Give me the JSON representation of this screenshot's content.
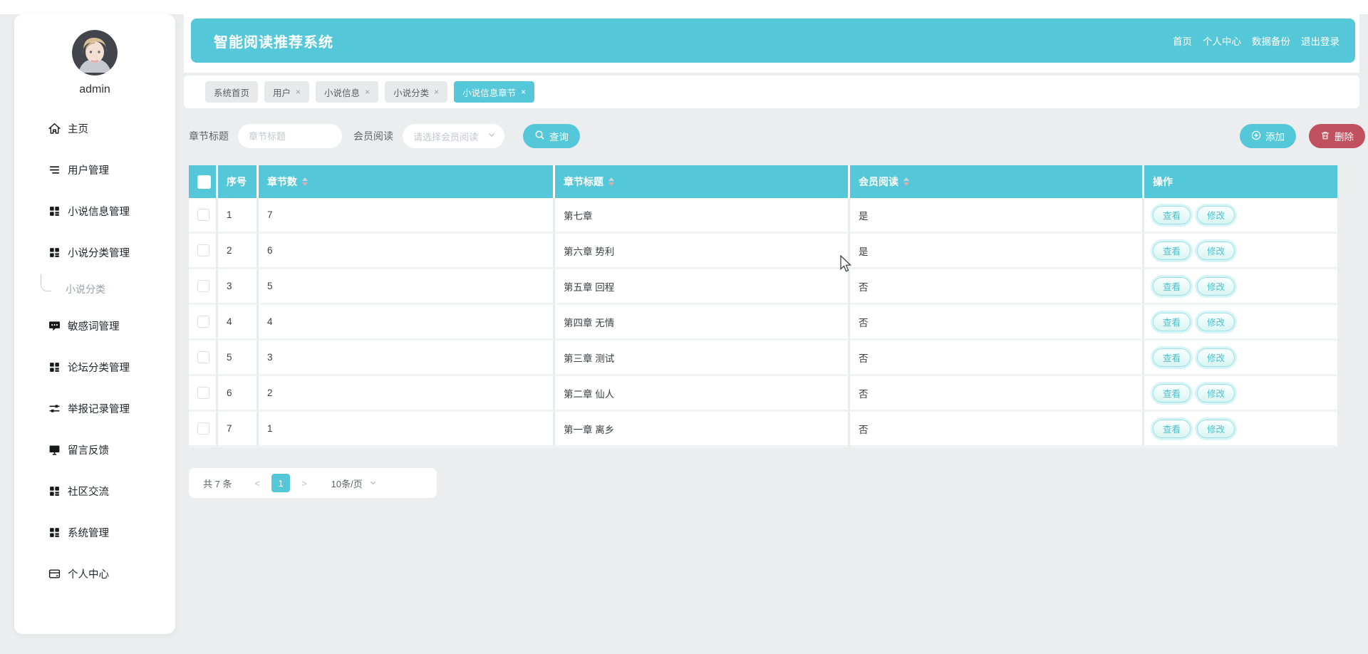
{
  "app": {
    "title": "智能阅读推荐系统"
  },
  "account": {
    "username": "admin",
    "avatar_icon": "anime-boy-avatar"
  },
  "header": {
    "nav_links": [
      {
        "name": "nav-home",
        "label": "首页"
      },
      {
        "name": "nav-personal-center",
        "label": "个人中心"
      },
      {
        "name": "nav-data-backup",
        "label": "数据备份"
      },
      {
        "name": "nav-logout",
        "label": "退出登录"
      }
    ]
  },
  "sidebar": {
    "items": [
      {
        "name": "home",
        "label": "主页",
        "icon": "home-icon",
        "sub": false
      },
      {
        "name": "user-management",
        "label": "用户管理",
        "icon": "list-icon",
        "sub": false
      },
      {
        "name": "novel-info-management",
        "label": "小说信息管理",
        "icon": "grid-icon",
        "sub": false
      },
      {
        "name": "novel-category-management",
        "label": "小说分类管理",
        "icon": "grid-icon",
        "sub": false
      },
      {
        "name": "novel-category",
        "label": "小说分类",
        "icon": "",
        "sub": true
      },
      {
        "name": "sensitive-word-management",
        "label": "敏感词管理",
        "icon": "comment-icon",
        "sub": false
      },
      {
        "name": "forum-category-management",
        "label": "论坛分类管理",
        "icon": "grid-icon",
        "sub": false
      },
      {
        "name": "report-record-management",
        "label": "举报记录管理",
        "icon": "sliders-icon",
        "sub": false
      },
      {
        "name": "message-feedback",
        "label": "留言反馈",
        "icon": "monitor-icon",
        "sub": false
      },
      {
        "name": "community-exchange",
        "label": "社区交流",
        "icon": "grid-icon",
        "sub": false
      },
      {
        "name": "system-management",
        "label": "系统管理",
        "icon": "grid-icon",
        "sub": false
      },
      {
        "name": "personal-center",
        "label": "个人中心",
        "icon": "card-icon",
        "sub": false
      }
    ]
  },
  "tabs": [
    {
      "name": "tab-system-home",
      "label": "系统首页",
      "closable": false,
      "active": false
    },
    {
      "name": "tab-user",
      "label": "用户",
      "closable": true,
      "active": false
    },
    {
      "name": "tab-novel-info",
      "label": "小说信息",
      "closable": true,
      "active": false
    },
    {
      "name": "tab-novel-category",
      "label": "小说分类",
      "closable": true,
      "active": false
    },
    {
      "name": "tab-novel-info-chapter",
      "label": "小说信息章节",
      "closable": true,
      "active": true
    }
  ],
  "filters": {
    "chapter_title_label": "章节标题",
    "chapter_title_placeholder": "章节标题",
    "member_read_label": "会员阅读",
    "member_read_placeholder": "请选择会员阅读",
    "search_button": "查询"
  },
  "toolbar": {
    "add_button": "添加",
    "delete_button": "删除"
  },
  "table": {
    "columns": [
      {
        "key": "no",
        "label": "序号",
        "sortable": false
      },
      {
        "key": "count",
        "label": "章节数",
        "sortable": true
      },
      {
        "key": "title",
        "label": "章节标题",
        "sortable": true
      },
      {
        "key": "member",
        "label": "会员阅读",
        "sortable": true
      },
      {
        "key": "ops",
        "label": "操作",
        "sortable": false
      }
    ],
    "rows": [
      {
        "no": "1",
        "count": "7",
        "title": "第七章",
        "member": "是"
      },
      {
        "no": "2",
        "count": "6",
        "title": "第六章 势利",
        "member": "是"
      },
      {
        "no": "3",
        "count": "5",
        "title": "第五章 回程",
        "member": "否"
      },
      {
        "no": "4",
        "count": "4",
        "title": "第四章 无情",
        "member": "否"
      },
      {
        "no": "5",
        "count": "3",
        "title": "第三章 测试",
        "member": "否"
      },
      {
        "no": "6",
        "count": "2",
        "title": "第二章 仙人",
        "member": "否"
      },
      {
        "no": "7",
        "count": "1",
        "title": "第一章 离乡",
        "member": "否"
      }
    ],
    "row_actions": [
      {
        "name": "view",
        "label": "查看"
      },
      {
        "name": "edit",
        "label": "修改"
      }
    ]
  },
  "pagination": {
    "total": "共 7 条",
    "prev": "<",
    "page": "1",
    "next": ">",
    "page_size": "10条/页"
  },
  "colors": {
    "accent_teal": "#54c8d8",
    "danger_red": "#c0505e"
  }
}
